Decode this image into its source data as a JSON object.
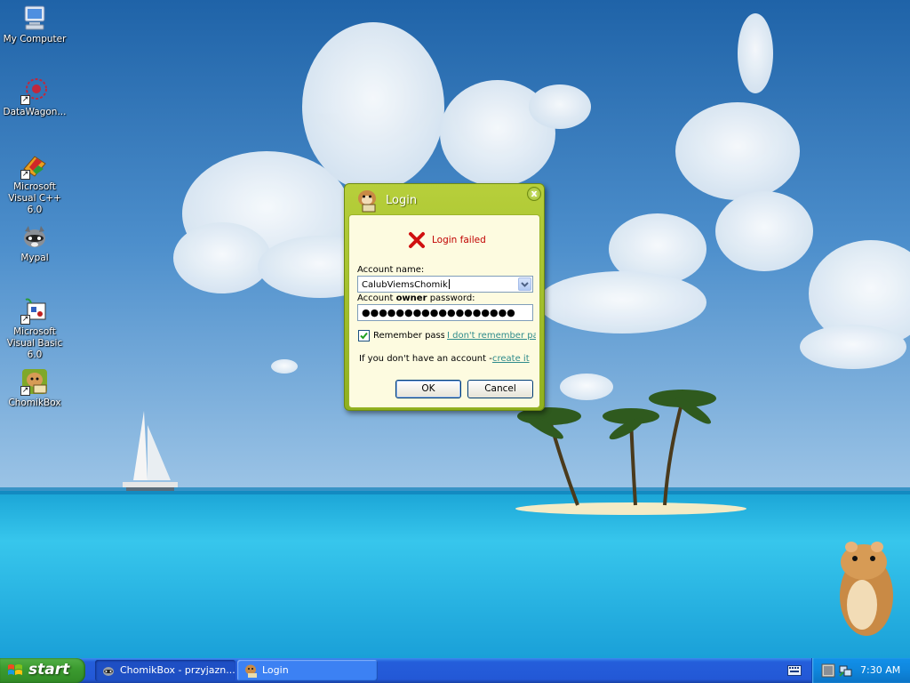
{
  "desktop": {
    "icons": [
      {
        "label": "My Computer"
      },
      {
        "label": "DataWagon..."
      },
      {
        "label": "Microsoft Visual C++ 6.0"
      },
      {
        "label": "Mypal"
      },
      {
        "label": "Microsoft Visual Basic 6.0"
      },
      {
        "label": "ChomikBox"
      }
    ]
  },
  "login_dialog": {
    "title": "Login",
    "close_symbol": "x",
    "error_message": "Login failed",
    "account_label": "Account name:",
    "account_value": "CalubViemsChomik",
    "password_label_prefix": "Account ",
    "password_label_bold": "owner",
    "password_label_suffix": " password:",
    "password_mask": "●●●●●●●●●●●●●●●●●●",
    "remember_label": "Remember passw",
    "remember_checked": true,
    "forgot_link": "I don't remember pas",
    "no_account_text": "If you don't have an account -",
    "create_link": "create it",
    "ok_label": "OK",
    "cancel_label": "Cancel"
  },
  "taskbar": {
    "start_label": "start",
    "tasks": [
      {
        "label": "ChomikBox - przyjazn...",
        "icon": "raccoon-icon"
      },
      {
        "label": "Login",
        "icon": "hamster-icon"
      }
    ],
    "clock": "7:30 AM"
  },
  "colors": {
    "dialog_frame": "#9fbf25",
    "dialog_body": "#fdfbe0",
    "error_text": "#c00000",
    "link": "#2e8b8b",
    "taskbar": "#245edb",
    "start_button": "#3c9c30"
  }
}
